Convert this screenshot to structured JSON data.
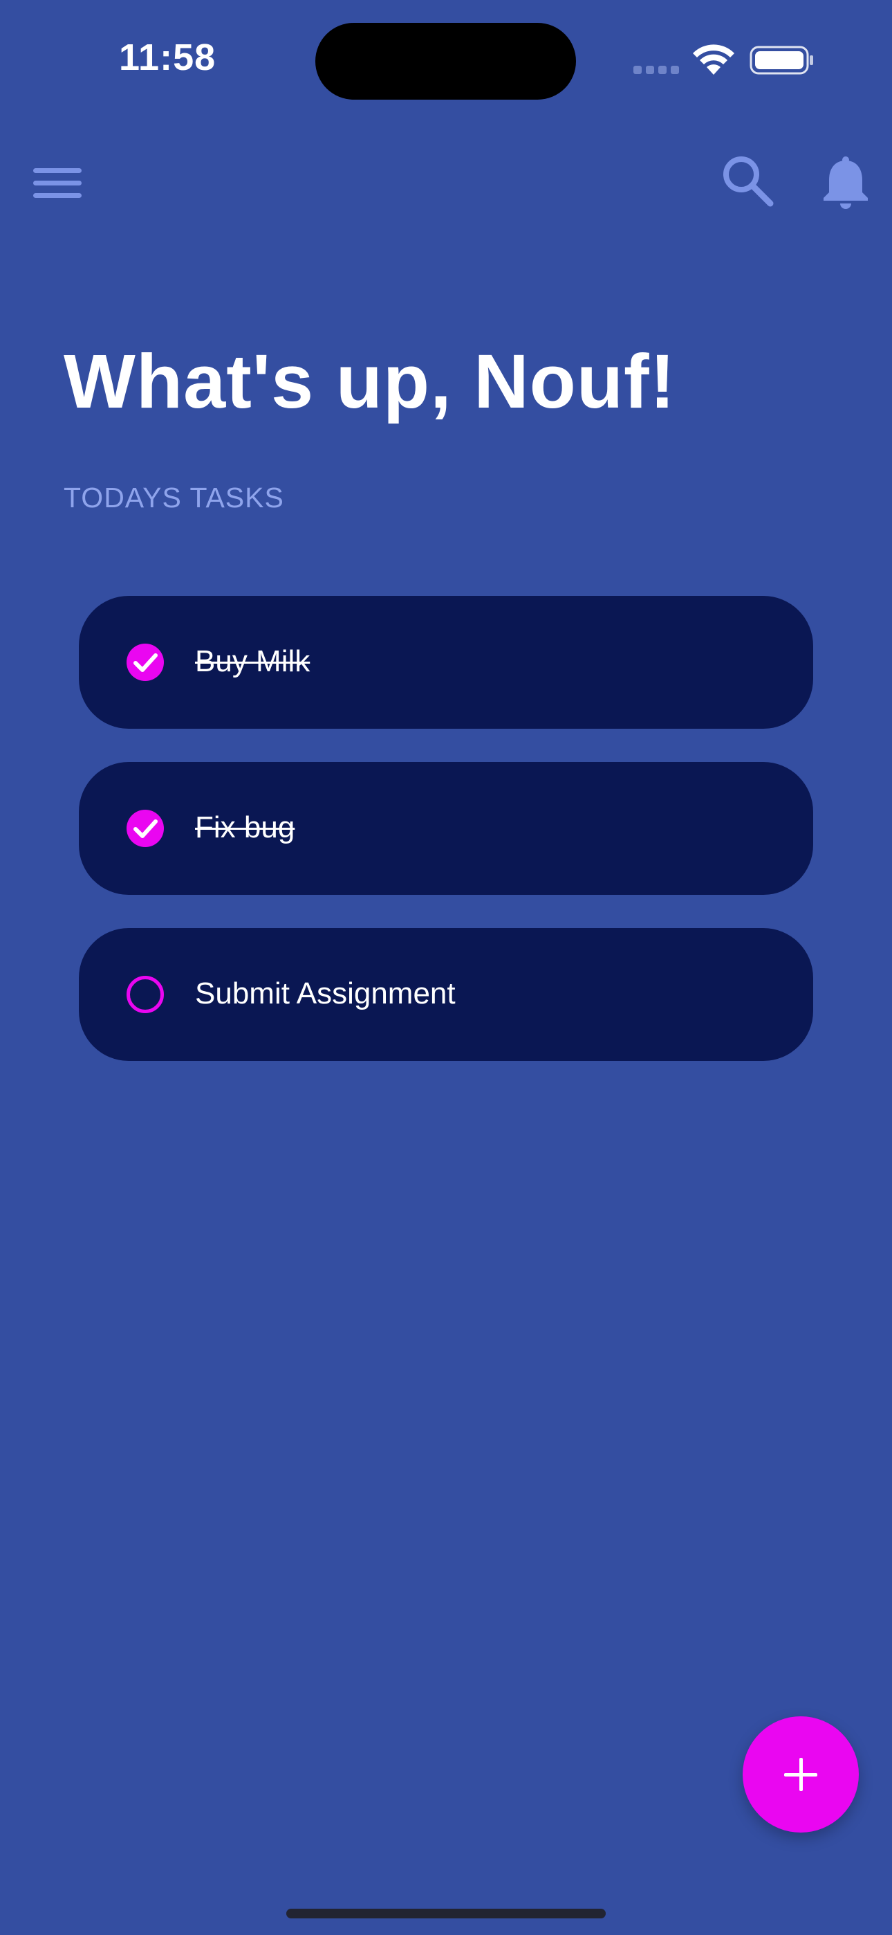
{
  "status_bar": {
    "time": "11:58"
  },
  "top_bar": {
    "icons": [
      "menu-icon",
      "search-icon",
      "bell-icon"
    ]
  },
  "header": {
    "greeting": "What's up, Nouf!",
    "section_label": "TODAYS TASKS"
  },
  "tasks": [
    {
      "label": "Buy Milk",
      "completed": true
    },
    {
      "label": "Fix bug",
      "completed": true
    },
    {
      "label": "Submit Assignment",
      "completed": false
    }
  ],
  "fab": {
    "icon": "plus-icon"
  },
  "colors": {
    "background": "#344ea1",
    "card": "#0a1753",
    "accent": "#ea06f1",
    "muted_icon": "#7b93e6",
    "section_label": "#8fa4ec"
  }
}
